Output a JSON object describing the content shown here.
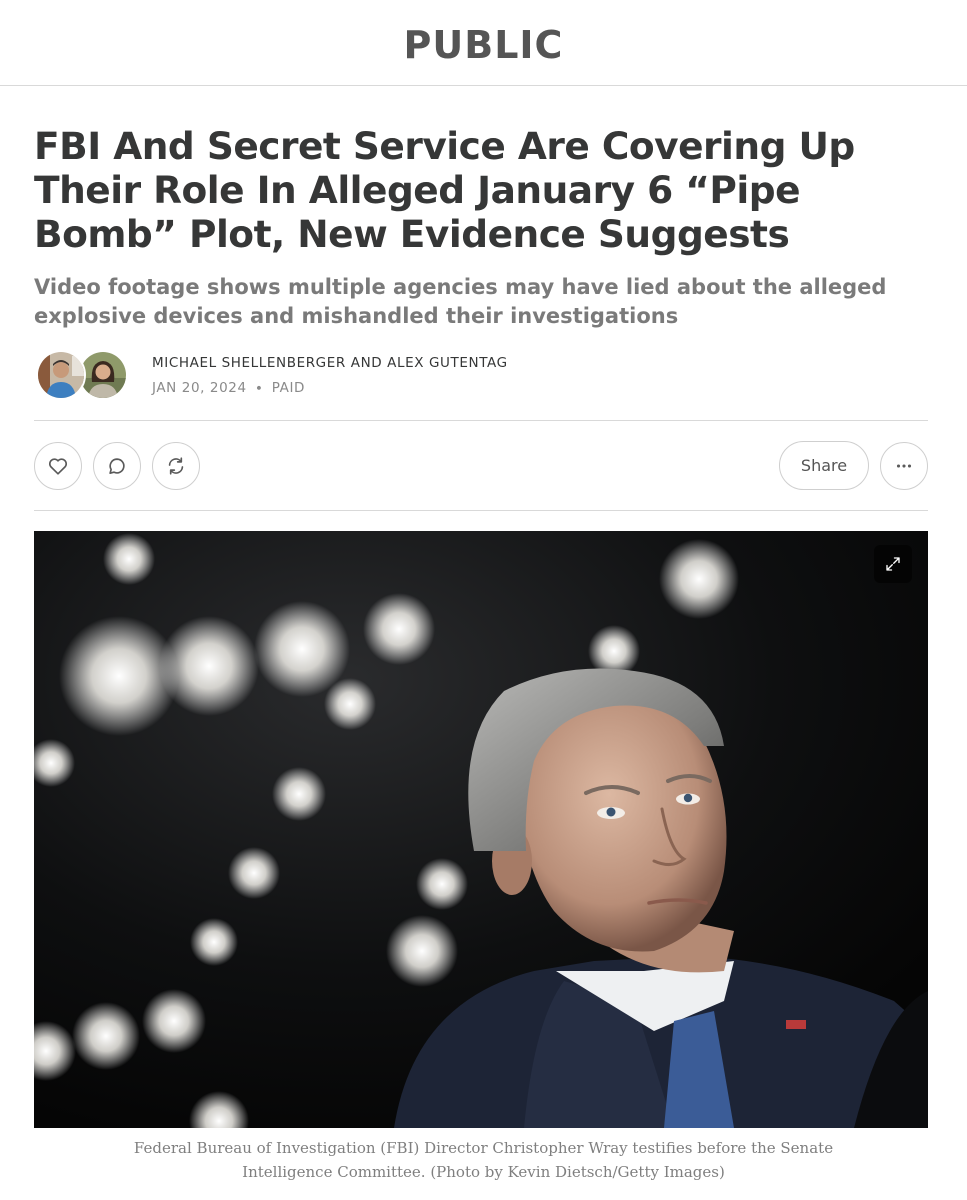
{
  "publication": {
    "name": "PUBLIC"
  },
  "article": {
    "title": "FBI And Secret Service Are Covering Up Their Role In Alleged January 6 “Pipe Bomb” Plot, New Evidence Suggests",
    "subtitle": "Video footage shows multiple agencies may have lied about the alleged explosive devices and mishandled their investigations",
    "authors": "MICHAEL SHELLENBERGER AND ALEX GUTENTAG",
    "date": "JAN 20, 2024",
    "separator": "∙",
    "access": "PAID"
  },
  "actions": {
    "like_icon": "heart-icon",
    "comment_icon": "comment-icon",
    "restack_icon": "restack-icon",
    "share_label": "Share",
    "more_icon": "more-dots-icon"
  },
  "image": {
    "expand_icon": "expand-icon",
    "caption": "Federal Bureau of Investigation (FBI) Director Christopher Wray testifies before the Senate Intelligence Committee. (Photo by Kevin Dietsch/Getty Images)"
  },
  "colors": {
    "text": "#363737",
    "muted": "#7a7a7a",
    "rule": "#d9d9d9",
    "photo_bg": "#0a0b0c"
  }
}
